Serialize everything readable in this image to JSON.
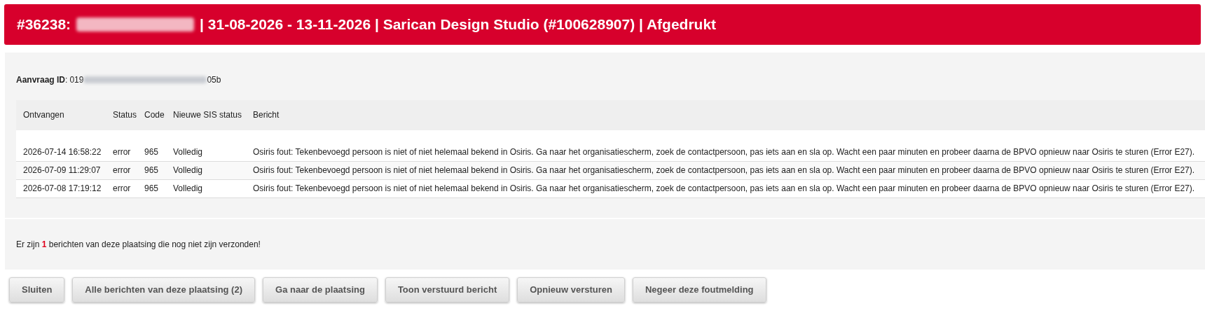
{
  "header": {
    "number": "#36238:",
    "rest": "| 31-08-2026 - 13-11-2026 | Sarican Design Studio (#100628907) | Afgedrukt"
  },
  "request_id": {
    "label": "Aanvraag ID",
    "separator": ":",
    "prefix": "019",
    "suffix": "05b"
  },
  "table": {
    "columns": [
      "Ontvangen",
      "Status",
      "Code",
      "Nieuwe SIS status",
      "Bericht"
    ],
    "rows": [
      {
        "received": "2026-07-14 16:58:22",
        "status": "error",
        "code": "965",
        "sis_status": "Volledig",
        "message": "Osiris fout: Tekenbevoegd persoon is niet of niet helemaal bekend in Osiris. Ga naar het organisatiescherm, zoek de contactpersoon, pas iets aan en sla op. Wacht een paar minuten en probeer daarna de BPVO opnieuw naar Osiris te sturen (Error E27)."
      },
      {
        "received": "2026-07-09 11:29:07",
        "status": "error",
        "code": "965",
        "sis_status": "Volledig",
        "message": "Osiris fout: Tekenbevoegd persoon is niet of niet helemaal bekend in Osiris. Ga naar het organisatiescherm, zoek de contactpersoon, pas iets aan en sla op. Wacht een paar minuten en probeer daarna de BPVO opnieuw naar Osiris te sturen (Error E27)."
      },
      {
        "received": "2026-07-08 17:19:12",
        "status": "error",
        "code": "965",
        "sis_status": "Volledig",
        "message": "Osiris fout: Tekenbevoegd persoon is niet of niet helemaal bekend in Osiris. Ga naar het organisatiescherm, zoek de contactpersoon, pas iets aan en sla op. Wacht een paar minuten en probeer daarna de BPVO opnieuw naar Osiris te sturen (Error E27)."
      }
    ]
  },
  "unsent_notice": {
    "before": "Er zijn",
    "count": "1",
    "after": "berichten van deze plaatsing die nog niet zijn verzonden!"
  },
  "buttons": [
    "Sluiten",
    "Alle berichten van deze plaatsing (2)",
    "Ga naar de plaatsing",
    "Toon verstuurd bericht",
    "Opnieuw versturen",
    "Negeer deze foutmelding"
  ]
}
